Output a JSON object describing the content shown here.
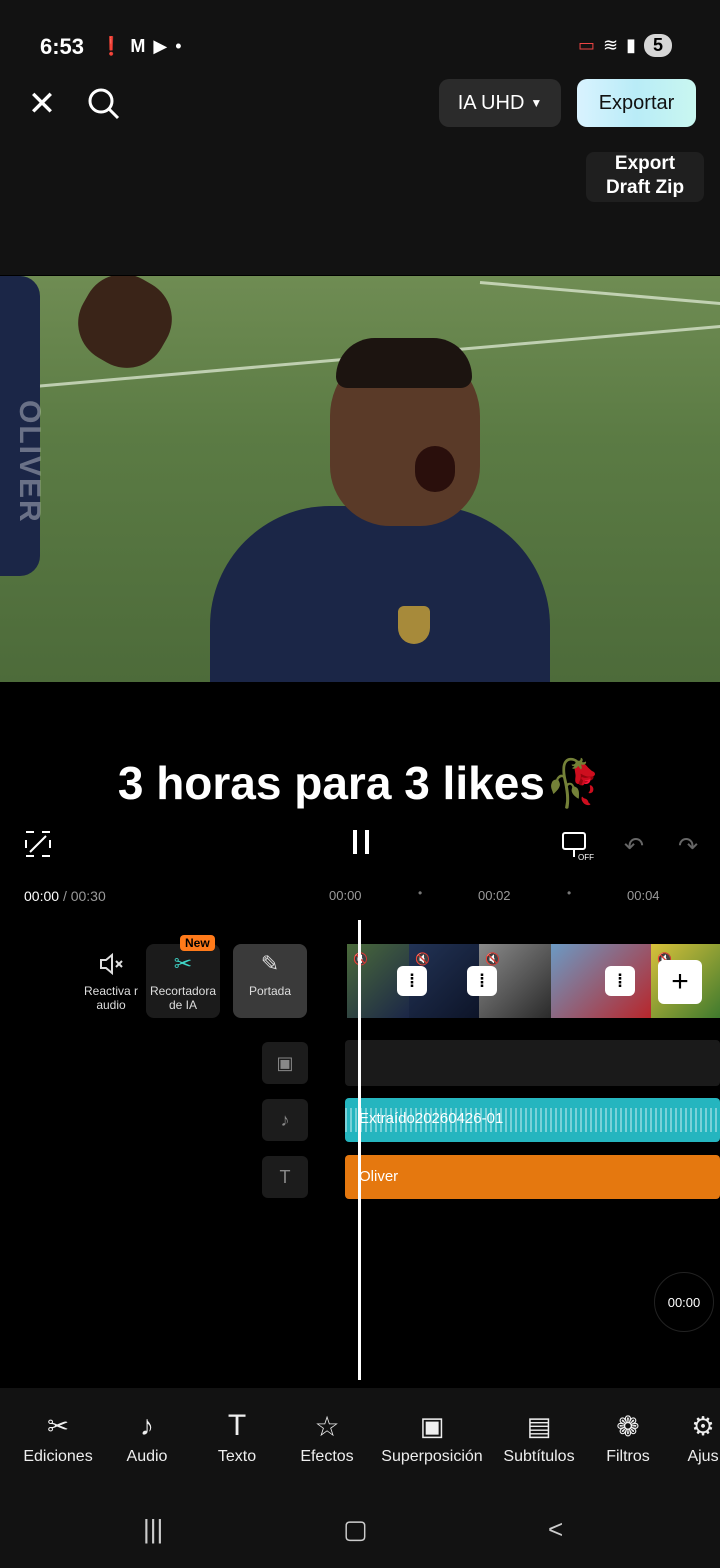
{
  "status_bar": {
    "time": "6:53",
    "notification_count": "5"
  },
  "toolbar": {
    "quality_label": "IA UHD",
    "export_label": "Exportar",
    "draft_line1": "Export",
    "draft_line2": "Draft Zip"
  },
  "preview": {
    "watermark": "OLIVER"
  },
  "caption": "3 horas para 3 likes🥀",
  "playback": {
    "current_time": "00:00",
    "total_time": "/ 00:30",
    "ticks": [
      "00:00",
      "00:02",
      "00:04"
    ]
  },
  "timeline": {
    "tools": [
      {
        "label": "Reactiva r audio"
      },
      {
        "label": "Recortadora de IA"
      },
      {
        "label": "Portada"
      }
    ],
    "new_badge": "New",
    "audio_clip_label": "Extraído20260426-01",
    "text_clip_label": "Oliver",
    "playhead_time": "00:00"
  },
  "bottom_tools": [
    {
      "label": "Ediciones",
      "icon": "scissors-icon"
    },
    {
      "label": "Audio",
      "icon": "music-note-icon"
    },
    {
      "label": "Texto",
      "icon": "text-icon"
    },
    {
      "label": "Efectos",
      "icon": "star-effects-icon"
    },
    {
      "label": "Superposición",
      "icon": "overlay-icon"
    },
    {
      "label": "Subtítulos",
      "icon": "subtitles-icon"
    },
    {
      "label": "Filtros",
      "icon": "filters-icon"
    },
    {
      "label": "Ajus",
      "icon": "adjust-icon"
    }
  ],
  "colors": {
    "audio_track": "#25b5bf",
    "text_track": "#e5780f",
    "export_gradient": "#c9f3fb",
    "new_badge": "#ff7a1a"
  }
}
